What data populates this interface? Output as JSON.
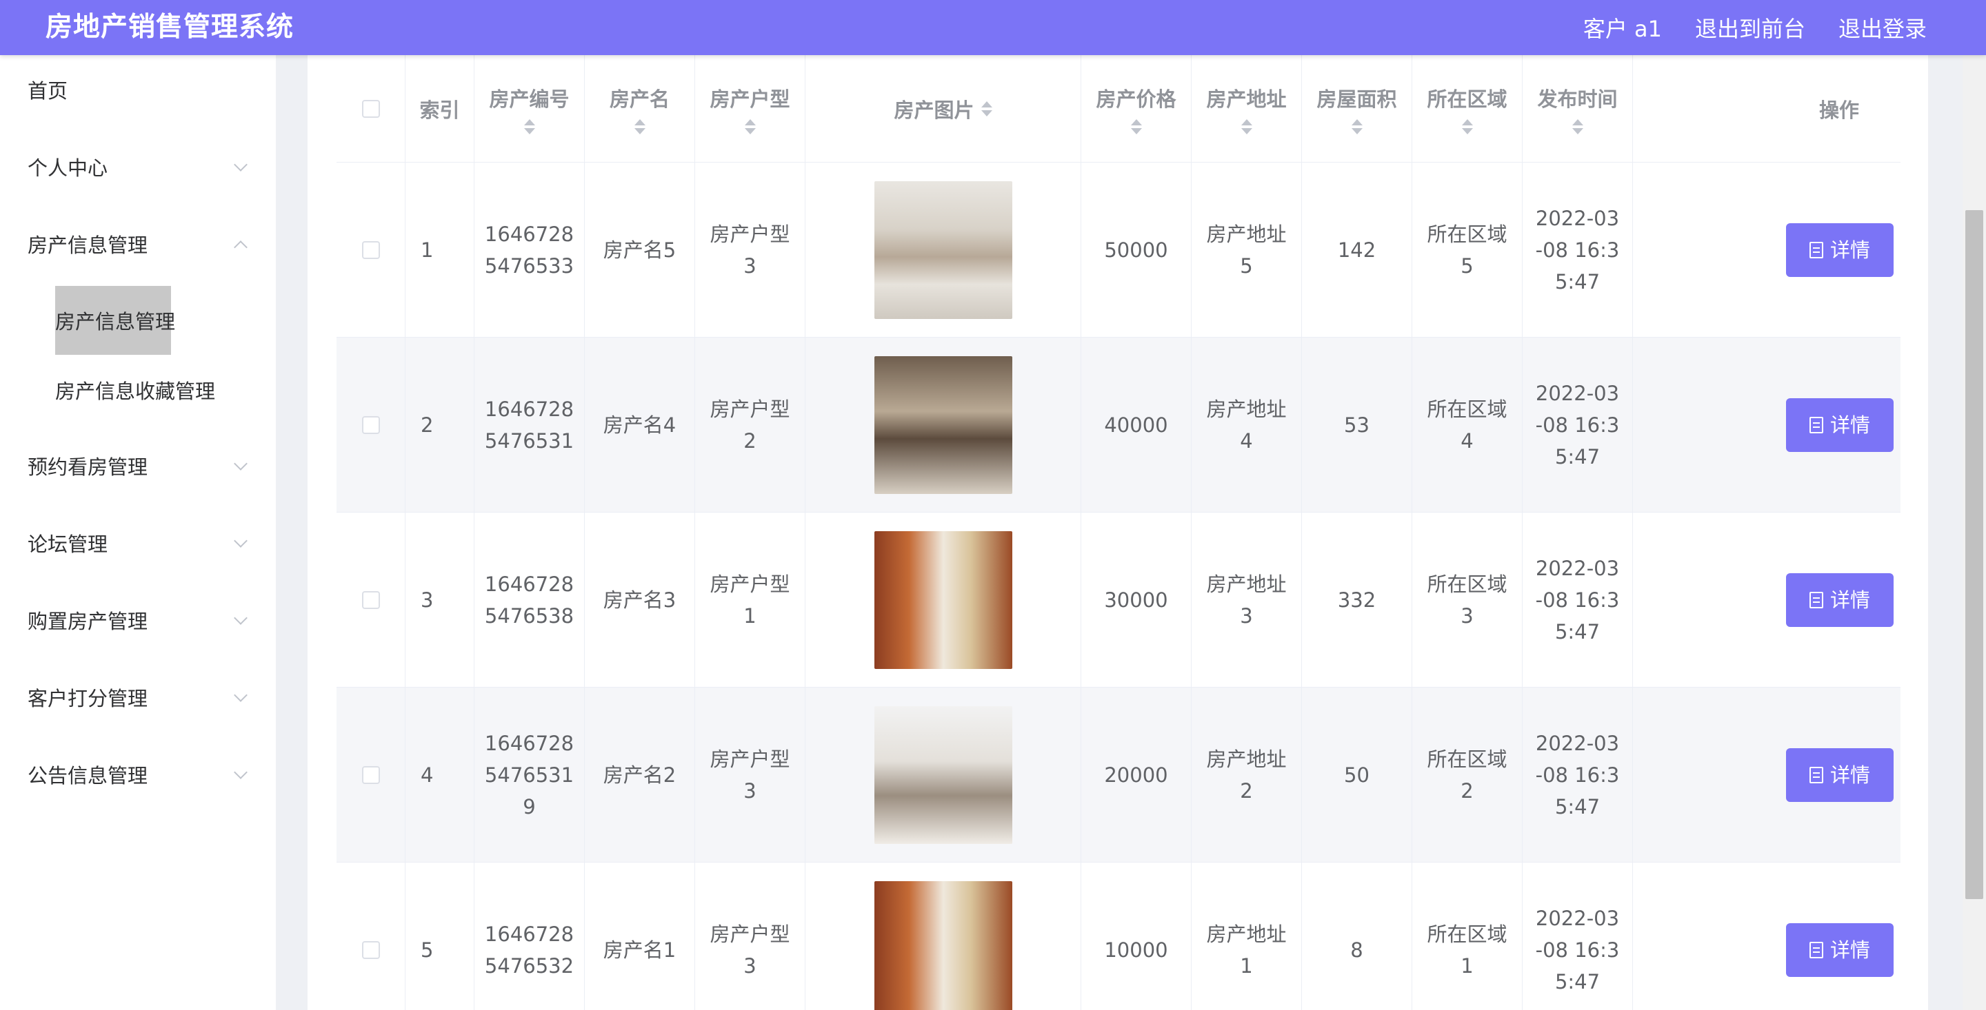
{
  "header": {
    "title": "房地产销售管理系统",
    "user": "客户 a1",
    "to_front": "退出到前台",
    "logout": "退出登录"
  },
  "sidebar": {
    "items": [
      {
        "label": "首页"
      },
      {
        "label": "个人中心"
      },
      {
        "label": "房产信息管理"
      },
      {
        "label": "房产信息管理"
      },
      {
        "label": "房产信息收藏管理"
      },
      {
        "label": "预约看房管理"
      },
      {
        "label": "论坛管理"
      },
      {
        "label": "购置房产管理"
      },
      {
        "label": "客户打分管理"
      },
      {
        "label": "公告信息管理"
      }
    ]
  },
  "table": {
    "headers": [
      "索引",
      "房产编号",
      "房产名",
      "房产户型",
      "房产图片",
      "房产价格",
      "房产地址",
      "房屋面积",
      "所在区域",
      "发布时间",
      "操作"
    ],
    "detail_label": "详情",
    "rows": [
      {
        "index": "1",
        "code": "1646728\n5476533",
        "name": "房产名5",
        "type": "房产户型\n3",
        "price": "50000",
        "addr": "房产地址\n5",
        "area": "142",
        "region": "所在区域\n5",
        "time": "2022-03\n-08 16:3\n5:47"
      },
      {
        "index": "2",
        "code": "1646728\n5476531",
        "name": "房产名4",
        "type": "房产户型\n2",
        "price": "40000",
        "addr": "房产地址\n4",
        "area": "53",
        "region": "所在区域\n4",
        "time": "2022-03\n-08 16:3\n5:47"
      },
      {
        "index": "3",
        "code": "1646728\n5476538",
        "name": "房产名3",
        "type": "房产户型\n1",
        "price": "30000",
        "addr": "房产地址\n3",
        "area": "332",
        "region": "所在区域\n3",
        "time": "2022-03\n-08 16:3\n5:47"
      },
      {
        "index": "4",
        "code": "1646728\n5476531\n9",
        "name": "房产名2",
        "type": "房产户型\n3",
        "price": "20000",
        "addr": "房产地址\n2",
        "area": "50",
        "region": "所在区域\n2",
        "time": "2022-03\n-08 16:3\n5:47"
      },
      {
        "index": "5",
        "code": "1646728\n5476532",
        "name": "房产名1",
        "type": "房产户型\n3",
        "price": "10000",
        "addr": "房产地址\n1",
        "area": "8",
        "region": "所在区域\n1",
        "time": "2022-03\n-08 16:3\n5:47"
      }
    ]
  }
}
